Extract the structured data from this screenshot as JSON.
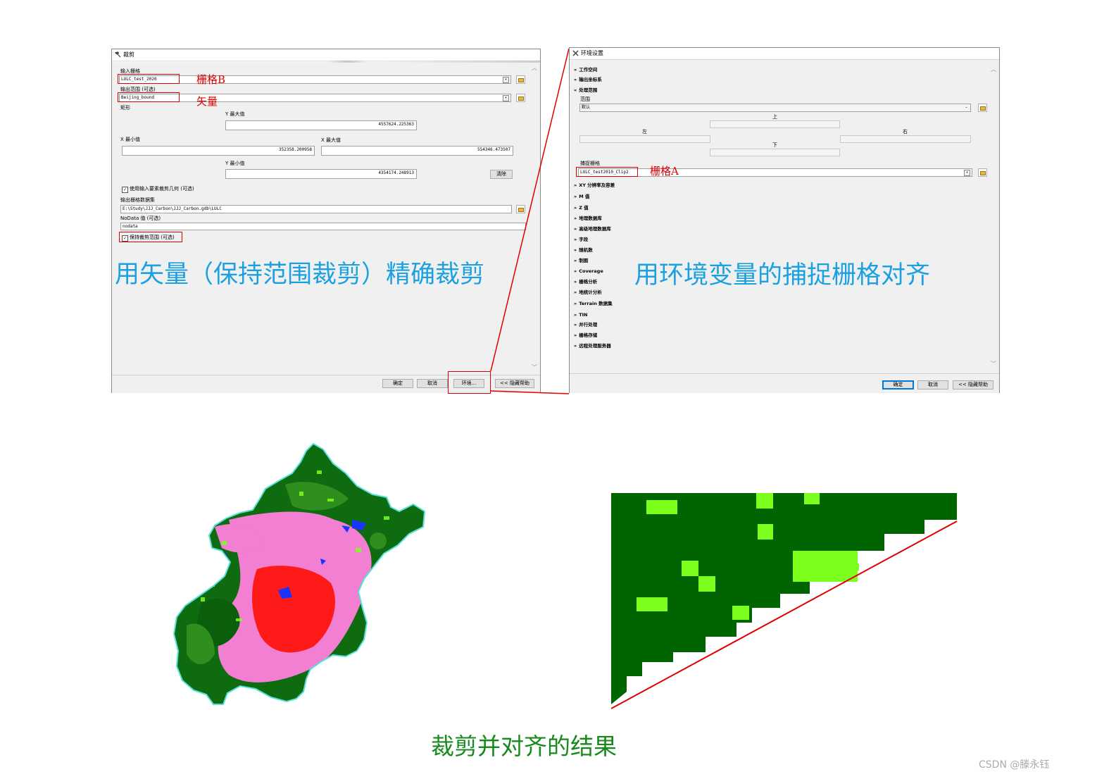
{
  "clip_dialog": {
    "title": "裁剪",
    "input_raster_label": "输入栅格",
    "input_raster_value": "LULC_test_2020",
    "output_extent_label": "输出范围 (可选)",
    "output_extent_value": "Beijing_bound",
    "rectangle_label": "矩形",
    "y_max_label": "Y 最大值",
    "y_max_value": "4557624.225363",
    "x_min_label": "X 最小值",
    "x_min_value": "352358.200958",
    "x_max_label": "X 最大值",
    "x_max_value": "554346.473507",
    "y_min_label": "Y 最小值",
    "y_min_value": "4354174.248913",
    "clear_button": "清除",
    "use_input_features_checkbox": "使用输入要素裁剪几何 (可选)",
    "use_input_features_checked": true,
    "output_dataset_label": "输出栅格数据集",
    "output_dataset_value": "E:\\Study\\JJJ_Carbon\\JJJ_Carbon.gdb\\LULC",
    "nodata_label": "NoData 值 (可选)",
    "nodata_value": "nodata",
    "maintain_extent_checkbox": "保持裁剪范围 (可选)",
    "maintain_extent_checked": true,
    "ok_button": "确定",
    "cancel_button": "取消",
    "env_button": "环境...",
    "hide_help_button": "<< 隐藏帮助"
  },
  "env_dialog": {
    "title": "环境设置",
    "sections_top": [
      "工作空间",
      "输出坐标系",
      "处理范围"
    ],
    "extent_label": "范围",
    "extent_value": "默认",
    "top_label": "上",
    "left_label": "左",
    "right_label": "右",
    "bottom_label": "下",
    "snap_raster_label": "捕捉栅格",
    "snap_raster_value": "LULC_test2010_Clip2",
    "sections_bottom": [
      "XY 分辨率及容差",
      "M 值",
      "Z 值",
      "地理数据库",
      "高级地理数据库",
      "字段",
      "随机数",
      "制图",
      "Coverage",
      "栅格分析",
      "地统计分析",
      "Terrain 数据集",
      "TIN",
      "并行处理",
      "栅格存储",
      "远程处理服务器"
    ],
    "ok_button": "确定",
    "cancel_button": "取消",
    "hide_help_button": "<< 隐藏帮助"
  },
  "annotations": {
    "raster_b": "栅格B",
    "vector": "矢量",
    "raster_a": "栅格A",
    "caption_left": "用矢量（保持范围裁剪）精确裁剪",
    "caption_right": "用环境变量的捕捉栅格对齐",
    "caption_bottom": "裁剪并对齐的结果",
    "watermark": "CSDN @滕永钰"
  },
  "colors": {
    "caption_blue": "#1ba0e0",
    "caption_green": "#178a1c",
    "annotation_red": "#e00000",
    "forest_dark": "#0f6b0f",
    "grass_light": "#7cff1c",
    "urban_red": "#ff1a1a",
    "cropland_pink": "#f27fd2",
    "water_blue": "#1a33ff"
  }
}
